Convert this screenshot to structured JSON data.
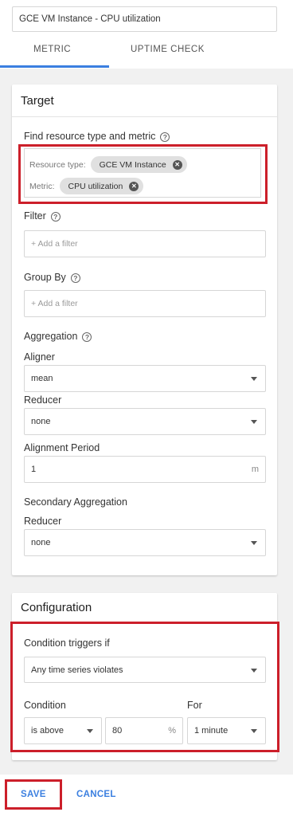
{
  "header": {
    "name_value": "GCE VM Instance - CPU utilization",
    "tabs": [
      {
        "label": "METRIC",
        "active": true
      },
      {
        "label": "UPTIME CHECK",
        "active": false
      }
    ]
  },
  "target": {
    "title": "Target",
    "find_label": "Find resource type and metric",
    "resource_type_label": "Resource type:",
    "resource_type_value": "GCE VM Instance",
    "metric_label": "Metric:",
    "metric_value": "CPU utilization",
    "filter_label": "Filter",
    "filter_placeholder": "+ Add a filter",
    "group_by_label": "Group By",
    "group_by_placeholder": "+ Add a filter",
    "aggregation_label": "Aggregation",
    "aligner_label": "Aligner",
    "aligner_value": "mean",
    "reducer_label": "Reducer",
    "reducer_value": "none",
    "alignment_period_label": "Alignment Period",
    "alignment_period_value": "1",
    "alignment_period_unit": "m",
    "secondary_aggregation_label": "Secondary Aggregation",
    "secondary_reducer_label": "Reducer",
    "secondary_reducer_value": "none"
  },
  "configuration": {
    "title": "Configuration",
    "condition_triggers_label": "Condition triggers if",
    "condition_triggers_value": "Any time series violates",
    "condition_label": "Condition",
    "condition_value": "is above",
    "threshold_value": "80",
    "threshold_unit": "%",
    "for_label": "For",
    "for_value": "1 minute"
  },
  "actions": {
    "save_label": "SAVE",
    "cancel_label": "CANCEL"
  },
  "colors": {
    "accent": "#3b7fe0",
    "highlight": "#cc1f2a"
  }
}
